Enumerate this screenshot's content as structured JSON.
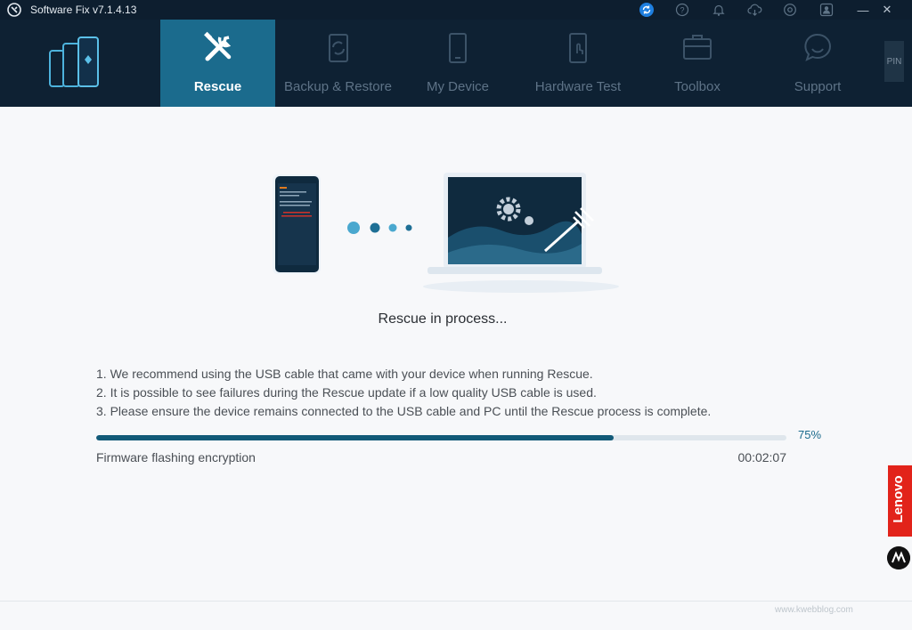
{
  "window": {
    "title": "Software Fix v7.1.4.13",
    "controls": {
      "minimize": "—",
      "maximize": "☐",
      "close": "✕"
    },
    "toolbar_icons": [
      "sync-icon",
      "help-icon",
      "bell-icon",
      "cloud-download-icon",
      "settings-icon",
      "account-icon"
    ]
  },
  "nav": {
    "tabs": [
      {
        "label": "Rescue",
        "icon": "wrench-screwdriver-icon",
        "active": true
      },
      {
        "label": "Backup & Restore",
        "icon": "backup-icon",
        "active": false
      },
      {
        "label": "My Device",
        "icon": "phone-icon",
        "active": false
      },
      {
        "label": "Hardware Test",
        "icon": "touch-phone-icon",
        "active": false
      },
      {
        "label": "Toolbox",
        "icon": "toolbox-icon",
        "active": false
      },
      {
        "label": "Support",
        "icon": "chat-bubble-icon",
        "active": false
      }
    ],
    "pin_label": "PIN"
  },
  "rescue": {
    "status_title": "Rescue in process...",
    "tips": [
      "1. We recommend using the USB cable that came with your device when running Rescue.",
      "2. It is possible to see failures during the Rescue update if a low quality USB cable is used.",
      "3. Please ensure the device remains connected to the USB cable and PC until the Rescue process is complete."
    ],
    "progress": {
      "percent": 75,
      "percent_label": "75%"
    },
    "step_label": "Firmware flashing encryption",
    "elapsed": "00:02:07"
  },
  "brand": {
    "lenovo": "Lenovo",
    "watermark": "www.kwebblog.com"
  },
  "colors": {
    "nav_bg": "#0e2133",
    "active_tab": "#1b6b8d",
    "progress_fill": "#125a78",
    "lenovo_red": "#e2231a"
  }
}
